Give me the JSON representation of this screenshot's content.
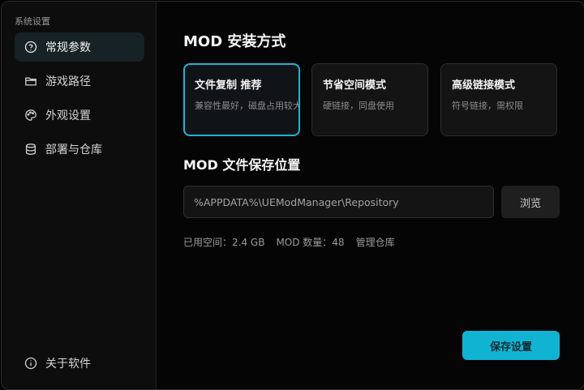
{
  "sidebar": {
    "title": "系统设置",
    "items": [
      {
        "label": "常规参数",
        "icon": "help-circle-icon",
        "active": true
      },
      {
        "label": "游戏路径",
        "icon": "folder-icon",
        "active": false
      },
      {
        "label": "外观设置",
        "icon": "palette-icon",
        "active": false
      },
      {
        "label": "部署与仓库",
        "icon": "database-icon",
        "active": false
      }
    ],
    "footer": {
      "label": "关于软件",
      "icon": "info-icon"
    }
  },
  "install": {
    "title": "MOD 安装方式",
    "options": [
      {
        "title": "文件复制  推荐",
        "desc": "兼容性最好，磁盘占用较大",
        "selected": true
      },
      {
        "title": "节省空间模式",
        "desc": "硬链接，同盘使用",
        "selected": false
      },
      {
        "title": "高级链接模式",
        "desc": "符号链接，需权限",
        "selected": false
      }
    ]
  },
  "storage": {
    "title": "MOD 文件保存位置",
    "path_value": "%APPDATA%\\UEModManager\\Repository",
    "browse_label": "浏览",
    "used_space": "已用空间：2.4 GB",
    "mod_count": "MOD 数量：48",
    "manage_label": "管理仓库"
  },
  "save_label": "保存设置",
  "colors": {
    "accent": "#10b4d2",
    "background": "#050505",
    "sidebar": "#0d0d0d"
  }
}
